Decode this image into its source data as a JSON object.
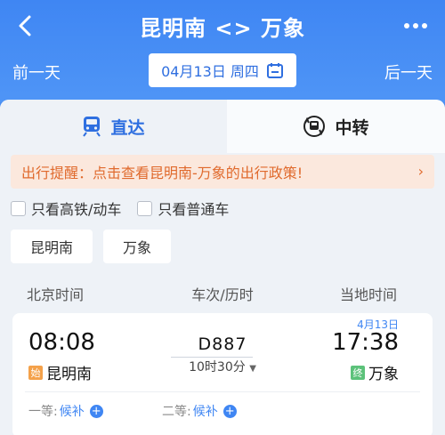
{
  "header": {
    "title": "昆明南 <> 万象",
    "prev_day": "前一天",
    "next_day": "后一天",
    "date": "04月13日 周四"
  },
  "tabs": [
    {
      "label": "直达",
      "active": true
    },
    {
      "label": "中转",
      "active": false
    }
  ],
  "notice": {
    "text": "出行提醒：点击查看昆明南-万象的出行政策!",
    "arrow": "›"
  },
  "filters": [
    {
      "label": "只看高铁/动车",
      "checked": false
    },
    {
      "label": "只看普通车",
      "checked": false
    }
  ],
  "stations": {
    "from": "昆明南",
    "to": "万象"
  },
  "columns": {
    "left": "北京时间",
    "middle": "车次/历时",
    "right": "当地时间"
  },
  "train": {
    "depart_time": "08:08",
    "depart_station": "昆明南",
    "start_badge": "始",
    "train_no": "D887",
    "duration": "10时30分",
    "arrive_date": "4月13日",
    "arrive_time": "17:38",
    "arrive_station": "万象",
    "end_badge": "终",
    "seats": [
      {
        "class": "一等:",
        "status": "候补"
      },
      {
        "class": "二等:",
        "status": "候补"
      }
    ]
  },
  "colors": {
    "accent": "#3f86f3",
    "notice": "#e06a2d",
    "start": "#f4a14a",
    "end": "#5cc27a"
  }
}
